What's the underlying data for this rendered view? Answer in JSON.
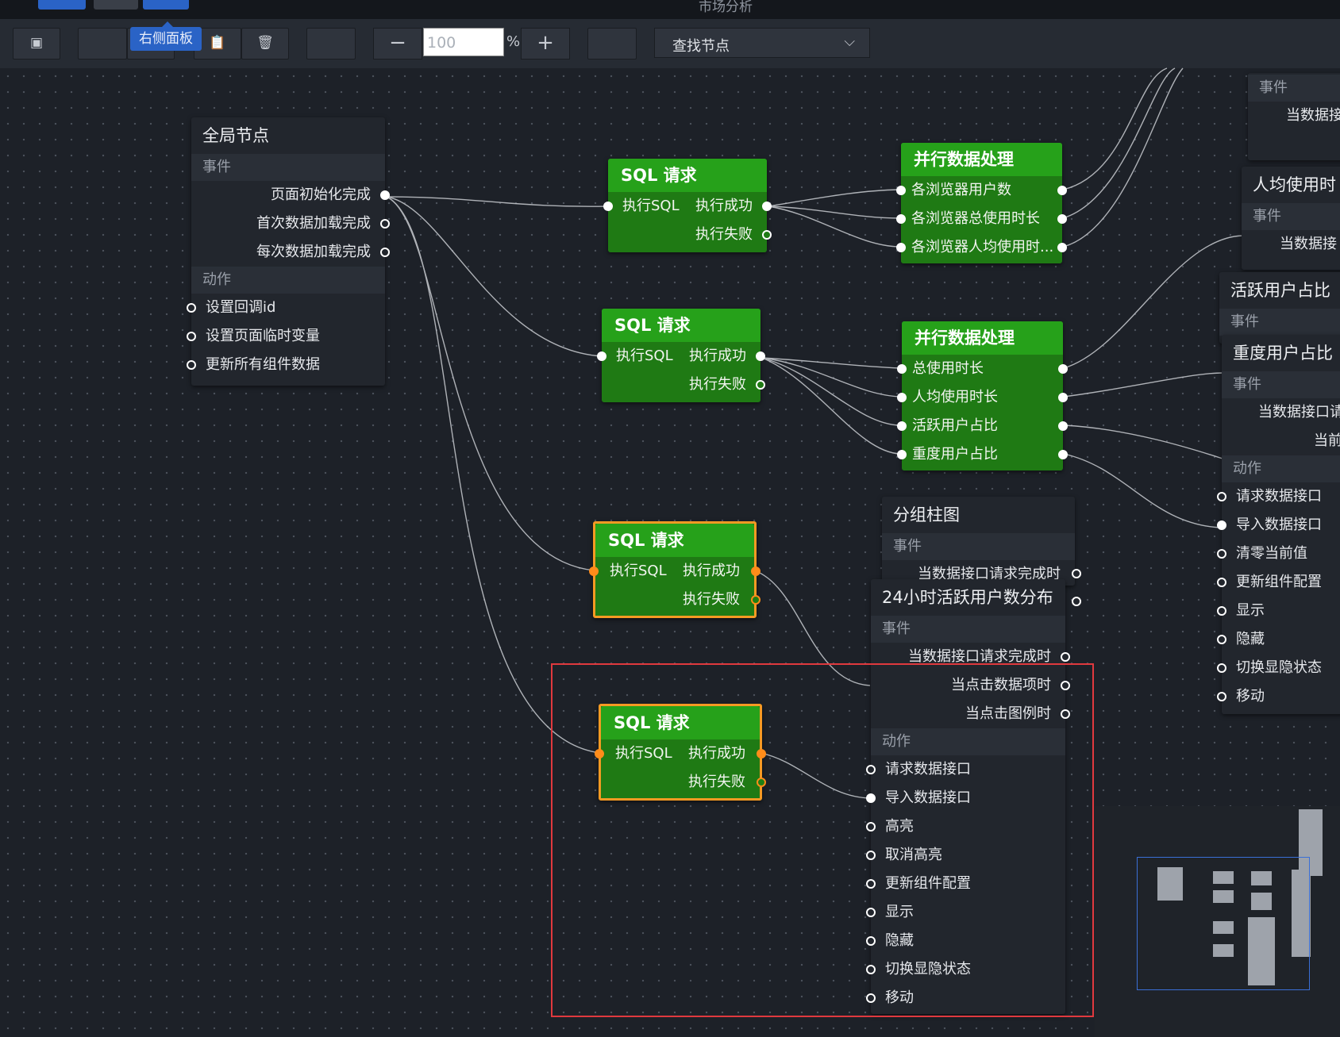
{
  "window": {
    "title": "市场分析"
  },
  "tooltip": "右侧面板",
  "zoom": {
    "value": "100",
    "unit": "%",
    "minus": "−",
    "plus": "+"
  },
  "search": {
    "label": "查找节点"
  },
  "global_node": {
    "title": "全局节点",
    "events_header": "事件",
    "events": [
      "页面初始化完成",
      "首次数据加载完成",
      "每次数据加载完成"
    ],
    "actions_header": "动作",
    "actions": [
      "设置回调id",
      "设置页面临时变量",
      "更新所有组件数据"
    ]
  },
  "sql_nodes": [
    {
      "title": "SQL 请求",
      "in": "执行SQL",
      "success": "执行成功",
      "fail": "执行失败"
    },
    {
      "title": "SQL 请求",
      "in": "执行SQL",
      "success": "执行成功",
      "fail": "执行失败"
    },
    {
      "title": "SQL 请求",
      "in": "执行SQL",
      "success": "执行成功",
      "fail": "执行失败"
    },
    {
      "title": "SQL 请求",
      "in": "执行SQL",
      "success": "执行成功",
      "fail": "执行失败"
    }
  ],
  "parallel_nodes": [
    {
      "title": "并行数据处理",
      "items": [
        "各浏览器用户数",
        "各浏览器总使用时长",
        "各浏览器人均使用时..."
      ]
    },
    {
      "title": "并行数据处理",
      "items": [
        "总使用时长",
        "人均使用时长",
        "活跃用户占比",
        "重度用户占比"
      ]
    }
  ],
  "grouped_bar_node": {
    "title": "分组柱图",
    "events_header": "事件",
    "event": "当数据接口请求完成时"
  },
  "hourly_node": {
    "title": "24小时活跃用户数分布",
    "events_header": "事件",
    "events": [
      "当数据接口请求完成时",
      "当点击数据项时",
      "当点击图例时"
    ],
    "actions_header": "动作",
    "actions": [
      "请求数据接口",
      "导入数据接口",
      "高亮",
      "取消高亮",
      "更新组件配置",
      "显示",
      "隐藏",
      "切换显隐状态",
      "移动"
    ]
  },
  "right_nodes": {
    "top": {
      "events_header": "事件",
      "event": "当数据接"
    },
    "per_capita": {
      "title": "人均使用时",
      "events_header": "事件",
      "event": "当数据接"
    },
    "active_ratio": {
      "title": "活跃用户占比",
      "events_header": "事件"
    },
    "heavy_ratio": {
      "title": "重度用户占比",
      "events_header": "事件",
      "events": [
        "当数据接口请",
        "当前"
      ],
      "actions_header": "动作",
      "actions": [
        "请求数据接口",
        "导入数据接口",
        "清零当前值",
        "更新组件配置",
        "显示",
        "隐藏",
        "切换显隐状态",
        "移动"
      ]
    }
  },
  "colors": {
    "accent": "#2a63c6",
    "node_green": "#26a11a",
    "selected_border": "#f59a23",
    "highlight_box": "#e0393e"
  }
}
